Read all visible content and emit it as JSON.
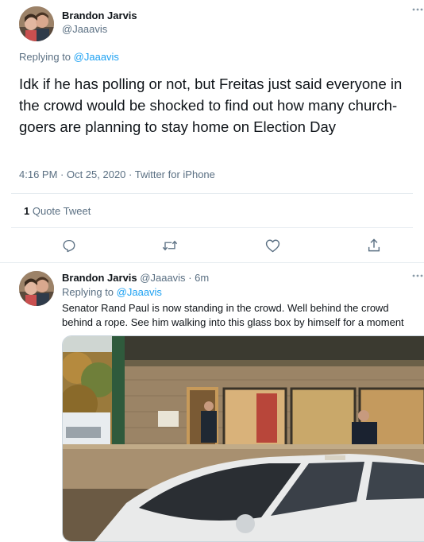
{
  "main_tweet": {
    "author_name": "Brandon Jarvis",
    "author_handle": "@Jaaavis",
    "replying_prefix": "Replying to ",
    "replying_handle": "@Jaaavis",
    "text": "Idk if he has polling or not, but Freitas just said everyone in the crowd would be shocked to find out how many church-goers are planning to stay home on Election Day",
    "timestamp": "4:16 PM · Oct 25, 2020 · Twitter for iPhone",
    "quote_count": "1",
    "quote_label": "Quote Tweet",
    "actions": [
      "reply-icon",
      "retweet-icon",
      "like-icon",
      "share-icon"
    ]
  },
  "reply_tweet": {
    "author_name": "Brandon Jarvis",
    "author_handle": "@Jaaavis",
    "time_ago": "· 6m",
    "replying_prefix": "Replying to ",
    "replying_handle": "@Jaaavis",
    "text": "Senator Rand Paul is now standing in the crowd. Well behind the crowd behind a rope. See him walking into this glass box by himself for a moment"
  },
  "colors": {
    "accent": "#1da1f2",
    "secondary_text": "#5b7083",
    "border": "#e6ecf0"
  }
}
